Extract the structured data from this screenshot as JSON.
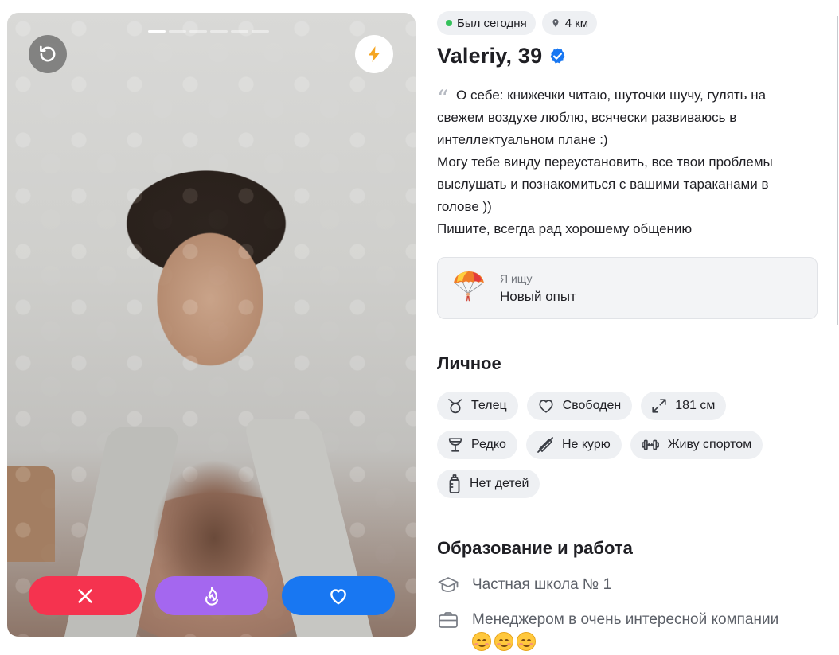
{
  "photo": {
    "story_count": 6,
    "story_active_index": 0
  },
  "actions": {
    "undo_icon": "undo-icon",
    "boost_icon": "lightning-icon",
    "dislike_icon": "close-icon",
    "superlike_icon": "flame-icon",
    "like_icon": "heart-icon",
    "colors": {
      "dislike": "#f5334f",
      "superlike": "#a467ef",
      "like": "#1877f2",
      "boost": "#f5a623"
    }
  },
  "status": {
    "online_label": "Был сегодня",
    "distance_label": "4 км"
  },
  "profile": {
    "name_age": "Valeriy, 39",
    "verified_icon": "verified-badge-icon",
    "about_lines": [
      "О себе: книжечки читаю, шуточки шучу, гулять на",
      "свежем воздухе люблю, всячески развиваюсь в",
      "интеллектуальном плане :)",
      "Могу тебе винду переустановить, все твои проблемы",
      "выслушать и познакомиться с вашими тараканами в",
      "голове ))",
      "Пишите, всегда рад хорошему общению"
    ]
  },
  "looking_for": {
    "label": "Я ищу",
    "value": "Новый опыт",
    "icon": "parachute-icon"
  },
  "personal": {
    "title": "Личное",
    "chips": [
      {
        "label": "Телец",
        "icon": "taurus-icon"
      },
      {
        "label": "Свободен",
        "icon": "heart-outline-icon"
      },
      {
        "label": "181 см",
        "icon": "expand-icon"
      },
      {
        "label": "Редко",
        "icon": "wine-glass-icon"
      },
      {
        "label": "Не курю",
        "icon": "no-smoking-icon"
      },
      {
        "label": "Живу спортом",
        "icon": "dumbbell-icon"
      },
      {
        "label": "Нет детей",
        "icon": "baby-bottle-icon"
      }
    ]
  },
  "education": {
    "title": "Образование и работа",
    "items": [
      {
        "label": "Частная школа № 1",
        "icon": "graduation-cap-icon"
      },
      {
        "label": "Менеджером в очень интересной компании",
        "icon": "briefcase-icon",
        "emoji": [
          "smiling-face-icon",
          "smiling-face-icon",
          "smiling-face-icon"
        ]
      }
    ]
  }
}
